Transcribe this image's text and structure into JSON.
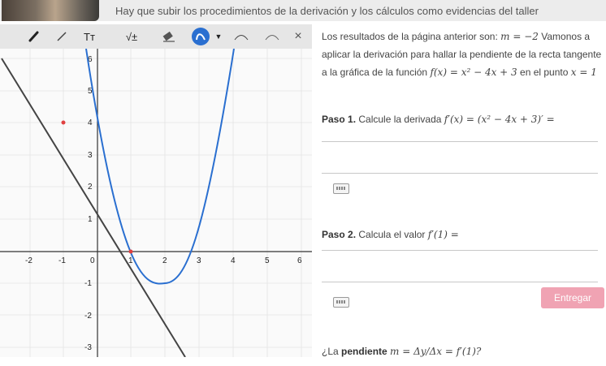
{
  "header": {
    "instruction": "Hay que subir los procedimientos de la derivación y los cálculos como evidencias del taller"
  },
  "toolbar": {
    "text_tool": "Tт",
    "sqrt_tool": "√±",
    "close_glyph": "×"
  },
  "graph": {
    "x_ticks": [
      "-2",
      "-1",
      "0",
      "1",
      "2",
      "3",
      "4",
      "5",
      "6"
    ],
    "y_ticks": [
      "6",
      "5",
      "4",
      "3",
      "2",
      "1",
      "-1",
      "-2",
      "-3"
    ],
    "curve_color": "#2a6fd0",
    "line_color": "#444444",
    "point_color": "#e04040"
  },
  "content": {
    "intro_1": "Los resultados de la página anterior son:",
    "intro_1_math": "m = −2",
    "intro_1_tail": "Vamonos a",
    "intro_2": "aplicar la derivación para hallar la pendiente de la recta tangente",
    "intro_3": "a la gráfica de la función",
    "intro_3_math": "f(x) = x² − 4x + 3",
    "intro_3_mid": "en el punto",
    "intro_3_point": "x = 1",
    "step1_label": "Paso 1.",
    "step1_text": "Calcule la derivada",
    "step1_math": "f′(x) = (x² − 4x + 3)′ =",
    "step2_label": "Paso 2.",
    "step2_text": "Calcula el valor",
    "step2_math": "f′(1) =",
    "submit_label": "Entregar",
    "question_pre": "¿La",
    "question_bold": "pendiente",
    "question_math": "m = Δy/Δx = f′(1)?"
  }
}
